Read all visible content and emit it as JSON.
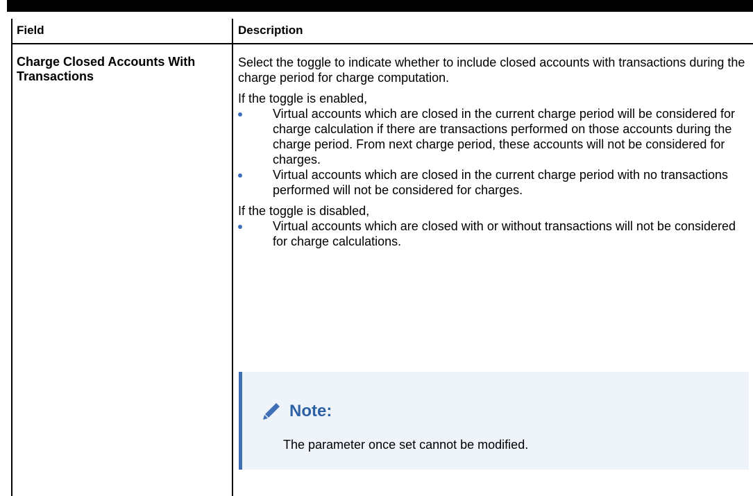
{
  "table": {
    "header": {
      "field": "Field",
      "description": "Description"
    },
    "row": {
      "field": "Charge Closed Accounts With Transactions",
      "intro": "Select the toggle to indicate whether to include closed accounts with transactions during the charge period for charge computation.",
      "enabled_lead": "If the toggle is enabled,",
      "enabled_bullets": [
        "Virtual accounts which are closed in the current charge period will be considered for charge calculation if there are transactions performed on those accounts during the charge period. From next charge period, these accounts will not be considered for charges.",
        "Virtual accounts which are closed in the current charge period with no transactions performed will not be considered for charges."
      ],
      "disabled_lead": "If the toggle is disabled,",
      "disabled_bullets": [
        "Virtual accounts which are closed with or without transactions will not be considered for charge calculations."
      ],
      "note": {
        "icon": "pencil-icon",
        "title": "Note:",
        "text": "The parameter once set cannot be modified."
      }
    }
  },
  "colors": {
    "bullet": "#3d6fbf",
    "note_background": "#eef4fa",
    "note_accent": "#3f6fb5",
    "note_title": "#2d61a3"
  }
}
